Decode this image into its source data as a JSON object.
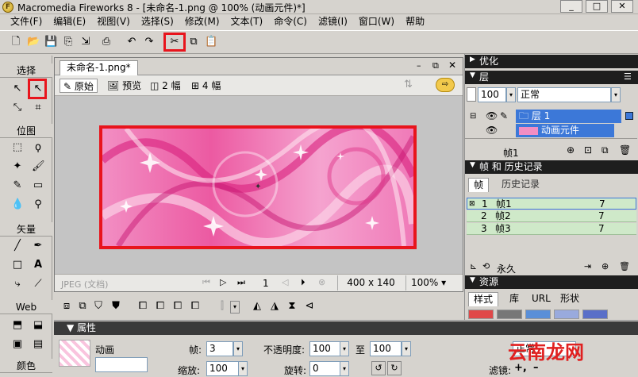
{
  "window": {
    "title": "Macromedia Fireworks 8 - [未命名-1.png @ 100% (动画元件)*]",
    "controls": [
      "_",
      "□",
      "✕"
    ]
  },
  "menu": [
    "文件(F)",
    "编辑(E)",
    "视图(V)",
    "选择(S)",
    "修改(M)",
    "文本(T)",
    "命令(C)",
    "滤镜(I)",
    "窗口(W)",
    "帮助"
  ],
  "toolbar": {
    "tooltip": "剪切"
  },
  "tools": {
    "sections": [
      "选择",
      "位图",
      "矢量",
      "Web",
      "颜色"
    ]
  },
  "document": {
    "tab_label": "未命名-1.png*",
    "tab_close": "✕",
    "views": [
      "原始",
      "预览",
      "2 幅",
      "4 幅"
    ],
    "status_left": "JPEG (文档)",
    "frame_number": "1",
    "size": "400 x 140",
    "zoom": "100%"
  },
  "properties": {
    "header": "属性",
    "symbol_type": "动画",
    "frames_label": "帧:",
    "frames_value": "3",
    "scale_label": "缩放:",
    "scale_value": "100",
    "opacity_label": "不透明度:",
    "opacity_from": "100",
    "to_label": "至",
    "opacity_to": "100",
    "rotate_label": "旋转:",
    "rotate_value": "0",
    "blend_value": "正常",
    "filter_label": "滤镜:"
  },
  "panels": {
    "optimize_title": "优化",
    "layers_title": "层",
    "opacity": "100",
    "blend": "正常",
    "layer_name": "层 1",
    "layer_object": "动画元件",
    "frame_label": "帧1",
    "frames_title": "帧 和 历史记录",
    "frames_tabs": [
      "帧",
      "历史记录"
    ],
    "frames": [
      {
        "num": "1",
        "name": "帧1",
        "delay": "7"
      },
      {
        "num": "2",
        "name": "帧2",
        "delay": "7"
      },
      {
        "num": "3",
        "name": "帧3",
        "delay": "7"
      }
    ],
    "loop_label": "永久",
    "assets_title": "资源",
    "assets_tabs": [
      "样式",
      "库",
      "URL",
      "形状"
    ]
  },
  "watermark": "云南龙网",
  "colors": {
    "highlight": "#e8141c",
    "canvas_pink": "#ee5aa0",
    "frame_row": "#cfe9c9",
    "panel_header": "#1e1e1e"
  }
}
